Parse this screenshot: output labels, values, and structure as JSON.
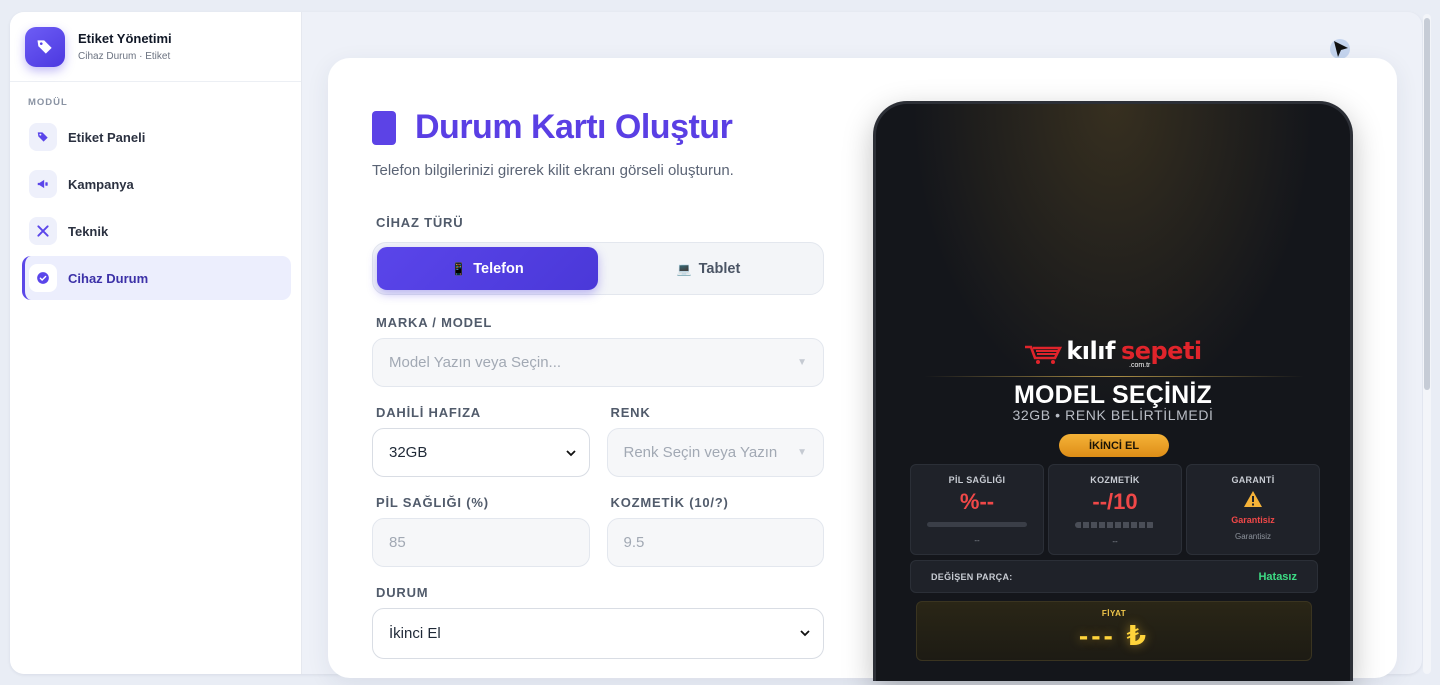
{
  "app": {
    "title": "Etiket Yönetimi",
    "subtitle": "Cihaz Durum · Etiket"
  },
  "sidebar": {
    "section_label": "MODÜL",
    "items": [
      {
        "label": "Etiket Paneli",
        "icon": "tag-icon",
        "active": false
      },
      {
        "label": "Kampanya",
        "icon": "megaphone-icon",
        "active": false
      },
      {
        "label": "Teknik",
        "icon": "tools-icon",
        "active": false
      },
      {
        "label": "Cihaz Durum",
        "icon": "check-circle-icon",
        "active": true
      }
    ]
  },
  "form": {
    "title": "Durum Kartı Oluştur",
    "subtitle": "Telefon bilgilerinizi girerek kilit ekranı görseli oluşturun.",
    "device_type": {
      "label": "CİHAZ TÜRÜ",
      "options": [
        {
          "label": "Telefon",
          "emoji": "📱",
          "active": true
        },
        {
          "label": "Tablet",
          "emoji": "💻",
          "active": false
        }
      ]
    },
    "brand_model": {
      "label": "MARKA / MODEL",
      "placeholder": "Model Yazın veya Seçin..."
    },
    "storage": {
      "label": "DAHİLİ HAFIZA",
      "value": "32GB"
    },
    "color": {
      "label": "RENK",
      "placeholder": "Renk Seçin veya Yazın"
    },
    "battery": {
      "label": "PİL SAĞLIĞI (%)",
      "placeholder": "85"
    },
    "cosmetic": {
      "label": "KOZMETİK (10/?)",
      "placeholder": "9.5"
    },
    "condition": {
      "label": "DURUM",
      "value": "İkinci El"
    }
  },
  "preview": {
    "logo_word_1": "kılıf",
    "logo_word_2": "sepeti",
    "logo_domain": ".com.tr",
    "model_title": "MODEL SEÇİNİZ",
    "model_sub": "32GB  •  RENK BELİRTİLMEDİ",
    "badge": "İKİNCİ EL",
    "stats": [
      {
        "label": "PİL SAĞLIĞI",
        "value": "%--",
        "foot": "--"
      },
      {
        "label": "KOZMETİK",
        "value": "--/10",
        "foot": "--"
      },
      {
        "label": "GARANTİ",
        "warn": "Garantisiz",
        "foot": "Garantisiz"
      }
    ],
    "part_label": "DEĞİŞEN PARÇA:",
    "part_value": "Hatasız",
    "price_label": "FİYAT",
    "price_value": "--- ₺"
  },
  "colors": {
    "accent": "#5a45ea",
    "title": "#5a3fe4",
    "danger": "#f04848",
    "success": "#3ddc84",
    "gold": "#ffd43b"
  }
}
